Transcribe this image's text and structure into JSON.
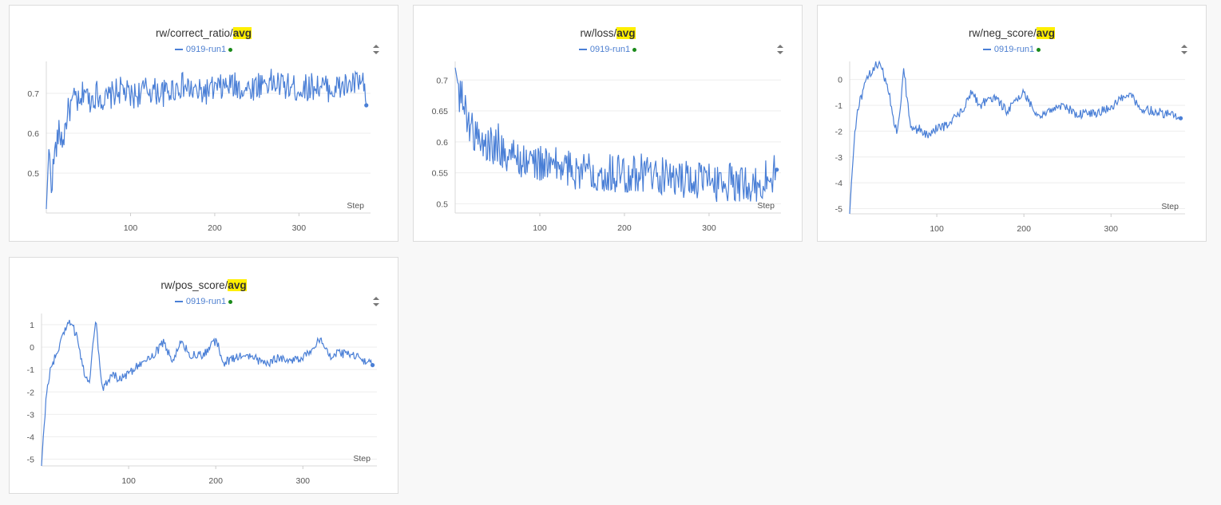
{
  "colors": {
    "line": "#4a7fd6",
    "grid": "#eeeeee",
    "highlight": "#ffef00",
    "status_dot": "#1a8a1a"
  },
  "chart_data": [
    {
      "type": "line",
      "title_prefix": "rw/correct_ratio/",
      "title_highlight": "avg",
      "legend": "0919-run1",
      "xlabel": "Step",
      "xlim": [
        0,
        385
      ],
      "ylim": [
        0.4,
        0.78
      ],
      "xticks": [
        100,
        200,
        300
      ],
      "yticks": [
        0.5,
        0.6,
        0.7
      ],
      "ytick_labels": [
        "0.5",
        "0.6",
        "0.7"
      ],
      "grid": true,
      "series": [
        {
          "name": "0919-run1",
          "x": [
            0,
            3,
            6,
            10,
            15,
            20,
            25,
            30,
            35,
            40,
            45,
            50,
            60,
            70,
            80,
            90,
            100,
            120,
            140,
            160,
            180,
            200,
            220,
            240,
            260,
            280,
            300,
            320,
            340,
            360,
            375,
            380
          ],
          "y": [
            0.41,
            0.56,
            0.47,
            0.55,
            0.6,
            0.58,
            0.65,
            0.67,
            0.69,
            0.66,
            0.72,
            0.68,
            0.7,
            0.68,
            0.7,
            0.71,
            0.69,
            0.71,
            0.7,
            0.72,
            0.7,
            0.71,
            0.72,
            0.71,
            0.73,
            0.72,
            0.71,
            0.72,
            0.71,
            0.72,
            0.73,
            0.67
          ],
          "noise": 0.035
        }
      ]
    },
    {
      "type": "line",
      "title_prefix": "rw/loss/",
      "title_highlight": "avg",
      "legend": "0919-run1",
      "xlabel": "Step",
      "xlim": [
        0,
        385
      ],
      "ylim": [
        0.485,
        0.73
      ],
      "xticks": [
        100,
        200,
        300
      ],
      "yticks": [
        0.5,
        0.55,
        0.6,
        0.65,
        0.7
      ],
      "ytick_labels": [
        "0.5",
        "0.55",
        "0.6",
        "0.65",
        "0.7"
      ],
      "grid": true,
      "series": [
        {
          "name": "0919-run1",
          "x": [
            0,
            5,
            10,
            15,
            20,
            30,
            40,
            50,
            60,
            80,
            100,
            120,
            140,
            160,
            180,
            200,
            220,
            240,
            260,
            280,
            300,
            320,
            340,
            360,
            380
          ],
          "y": [
            0.72,
            0.68,
            0.66,
            0.64,
            0.62,
            0.6,
            0.59,
            0.6,
            0.58,
            0.57,
            0.565,
            0.56,
            0.555,
            0.555,
            0.55,
            0.55,
            0.55,
            0.545,
            0.54,
            0.54,
            0.535,
            0.535,
            0.535,
            0.53,
            0.555
          ],
          "noise": 0.032
        }
      ]
    },
    {
      "type": "line",
      "title_prefix": "rw/neg_score/",
      "title_highlight": "avg",
      "legend": "0919-run1",
      "xlabel": "Step",
      "xlim": [
        0,
        385
      ],
      "ylim": [
        -5.2,
        0.7
      ],
      "xticks": [
        100,
        200,
        300
      ],
      "yticks": [
        0,
        -1,
        -2,
        -3,
        -4,
        -5
      ],
      "ytick_labels": [
        "0",
        "-1",
        "-2",
        "-3",
        "-4",
        "-5"
      ],
      "grid": true,
      "series": [
        {
          "name": "0919-run1",
          "x": [
            0,
            2,
            4,
            6,
            10,
            15,
            20,
            25,
            30,
            35,
            40,
            45,
            50,
            55,
            60,
            62,
            65,
            70,
            75,
            80,
            90,
            100,
            110,
            120,
            130,
            140,
            150,
            160,
            170,
            180,
            190,
            200,
            210,
            220,
            230,
            240,
            250,
            260,
            270,
            280,
            290,
            300,
            310,
            320,
            330,
            340,
            350,
            360,
            370,
            380
          ],
          "y": [
            -5.2,
            -4.0,
            -3.0,
            -2.0,
            -1.0,
            -0.5,
            0.0,
            0.3,
            0.6,
            0.5,
            0.1,
            -0.5,
            -1.5,
            -2.1,
            -0.3,
            0.6,
            -0.5,
            -1.8,
            -2.0,
            -1.9,
            -2.2,
            -1.9,
            -1.8,
            -1.5,
            -1.2,
            -0.5,
            -1.0,
            -0.7,
            -0.8,
            -1.2,
            -0.9,
            -0.5,
            -1.1,
            -1.4,
            -1.2,
            -1.0,
            -1.1,
            -1.4,
            -1.3,
            -1.3,
            -1.2,
            -1.1,
            -0.8,
            -0.5,
            -1.0,
            -1.2,
            -1.2,
            -1.3,
            -1.4,
            -1.5
          ],
          "noise": 0.18
        }
      ]
    },
    {
      "type": "line",
      "title_prefix": "rw/pos_score/",
      "title_highlight": "avg",
      "legend": "0919-run1",
      "xlabel": "Step",
      "xlim": [
        0,
        385
      ],
      "ylim": [
        -5.3,
        1.5
      ],
      "xticks": [
        100,
        200,
        300
      ],
      "yticks": [
        1,
        0,
        -1,
        -2,
        -3,
        -4,
        -5
      ],
      "ytick_labels": [
        "1",
        "0",
        "-1",
        "-2",
        "-3",
        "-4",
        "-5"
      ],
      "grid": true,
      "series": [
        {
          "name": "0919-run1",
          "x": [
            0,
            2,
            4,
            6,
            10,
            15,
            20,
            25,
            30,
            35,
            40,
            45,
            50,
            55,
            60,
            62,
            65,
            70,
            75,
            80,
            90,
            100,
            110,
            120,
            130,
            140,
            150,
            160,
            170,
            180,
            190,
            200,
            210,
            220,
            230,
            240,
            250,
            260,
            270,
            280,
            290,
            300,
            310,
            320,
            330,
            340,
            350,
            360,
            370,
            380
          ],
          "y": [
            -5.3,
            -4.0,
            -3.0,
            -2.0,
            -1.0,
            -0.5,
            0.0,
            0.5,
            1.2,
            1.0,
            0.5,
            -0.5,
            -1.2,
            -1.5,
            0.5,
            1.3,
            0.0,
            -1.8,
            -1.6,
            -1.2,
            -1.4,
            -1.2,
            -0.8,
            -0.5,
            -0.3,
            0.2,
            -0.6,
            0.2,
            -0.3,
            -0.4,
            -0.2,
            0.3,
            -0.7,
            -0.5,
            -0.4,
            -0.4,
            -0.6,
            -0.7,
            -0.5,
            -0.5,
            -0.6,
            -0.4,
            -0.1,
            0.4,
            -0.4,
            -0.3,
            -0.3,
            -0.4,
            -0.6,
            -0.8
          ],
          "noise": 0.2
        }
      ]
    }
  ]
}
